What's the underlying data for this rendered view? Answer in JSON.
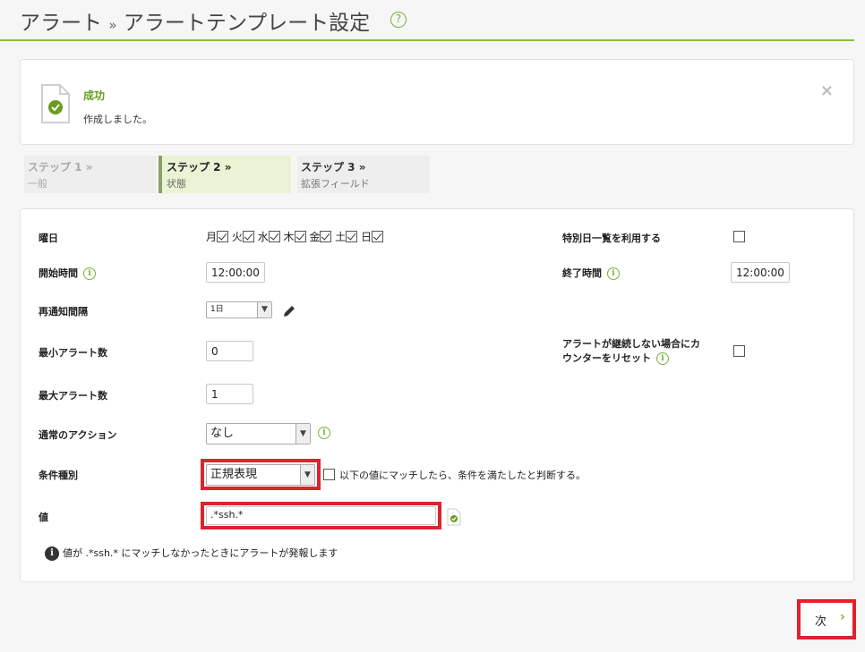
{
  "header": {
    "title_part1": "アラート",
    "separator": "»",
    "title_part2": "アラートテンプレート設定",
    "help": "?"
  },
  "alert": {
    "title": "成功",
    "message": "作成しました。",
    "close": "×"
  },
  "steps": [
    {
      "label": "ステップ 1 »",
      "sub": "一般"
    },
    {
      "label": "ステップ 2 »",
      "sub": "状態"
    },
    {
      "label": "ステップ 3 »",
      "sub": "拡張フィールド"
    }
  ],
  "form": {
    "weekday_label": "曜日",
    "days": [
      {
        "name": "月",
        "checked": true
      },
      {
        "name": "火",
        "checked": true
      },
      {
        "name": "水",
        "checked": true
      },
      {
        "name": "木",
        "checked": true
      },
      {
        "name": "金",
        "checked": true
      },
      {
        "name": "土",
        "checked": true
      },
      {
        "name": "日",
        "checked": true
      }
    ],
    "special_days_label": "特別日一覧を利用する",
    "start_time_label": "開始時間",
    "start_time": "12:00:00",
    "end_time_label": "終了時間",
    "end_time": "12:00:00",
    "renotify_label": "再通知間隔",
    "renotify_value": "1日",
    "min_alerts_label": "最小アラート数",
    "min_alerts": "0",
    "reset_label_line1": "アラートが継続しない場合にカ",
    "reset_label_line2": "ウンターをリセット",
    "max_alerts_label": "最大アラート数",
    "max_alerts": "1",
    "normal_action_label": "通常のアクション",
    "normal_action": "なし",
    "condition_type_label": "条件種別",
    "condition_type": "正規表現",
    "condition_checkbox_text": "以下の値にマッチしたら、条件を満たしたと判断する。",
    "value_label": "値",
    "value": ".*ssh.*",
    "note": "値が .*ssh.* にマッチしなかったときにアラートが発報します",
    "info": "i"
  },
  "next_button": {
    "label": "次",
    "chevron": "›"
  },
  "colors": {
    "accent_green": "#7ab13a",
    "highlight_red": "#e0212e"
  }
}
